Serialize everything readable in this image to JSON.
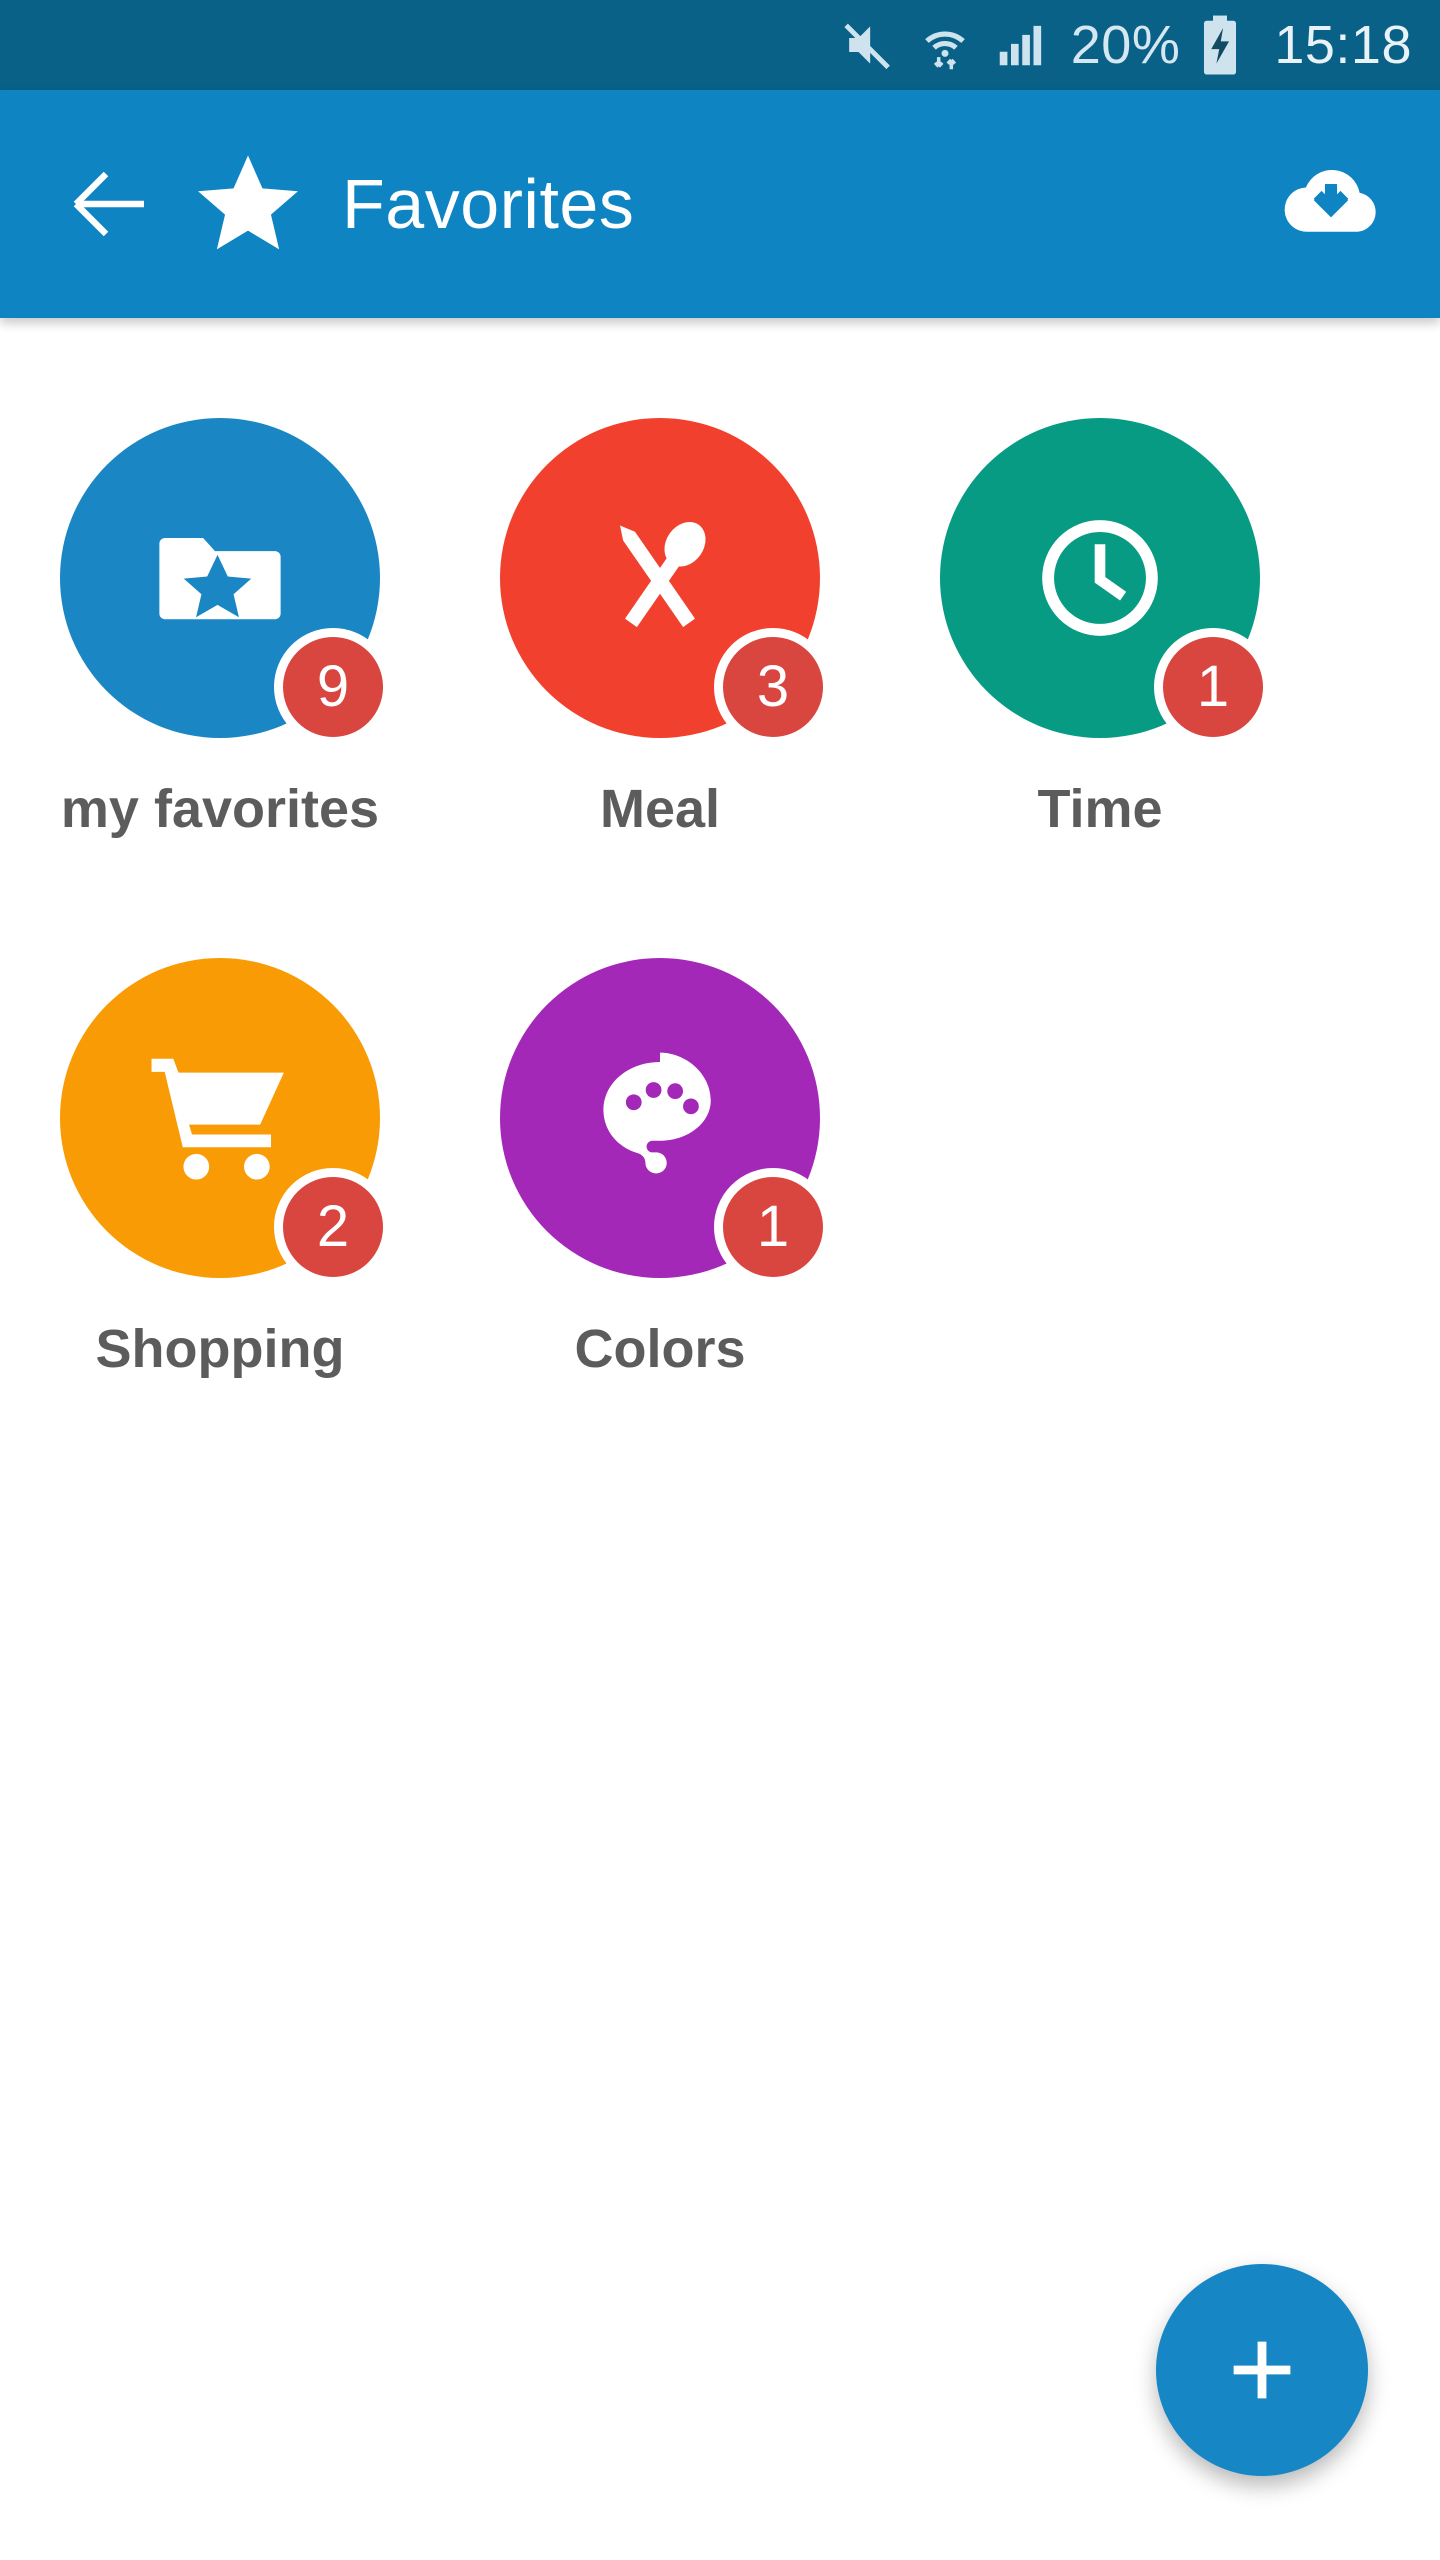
{
  "status_bar": {
    "background": "#0a6188",
    "mute_icon": "mute-icon",
    "wifi_icon": "wifi-transfer-icon",
    "signal_icon": "cellular-signal-icon",
    "battery_percent": "20%",
    "battery_icon": "battery-charging-icon",
    "time": "15:18"
  },
  "app_bar": {
    "background": "#0e84c2",
    "back_icon": "arrow-left-icon",
    "star_icon": "star-icon",
    "title": "Favorites",
    "action_icon": "cloud-download-icon"
  },
  "grid": {
    "items": [
      {
        "label": "my favorites",
        "badge": "9",
        "color": "#1b86c4",
        "icon": "folder-star-icon"
      },
      {
        "label": "Meal",
        "badge": "3",
        "color": "#f2402e",
        "icon": "cutlery-icon"
      },
      {
        "label": "Time",
        "badge": "1",
        "color": "#079b83",
        "icon": "clock-icon"
      },
      {
        "label": "Shopping",
        "badge": "2",
        "color": "#f99b05",
        "icon": "shopping-cart-icon"
      },
      {
        "label": "Colors",
        "badge": "1",
        "color": "#a328b8",
        "icon": "palette-icon"
      }
    ],
    "badge_color": "#d9453f",
    "label_color": "#5c5c5c"
  },
  "fab": {
    "icon": "plus-icon",
    "color": "#1686c4",
    "label": "+"
  }
}
